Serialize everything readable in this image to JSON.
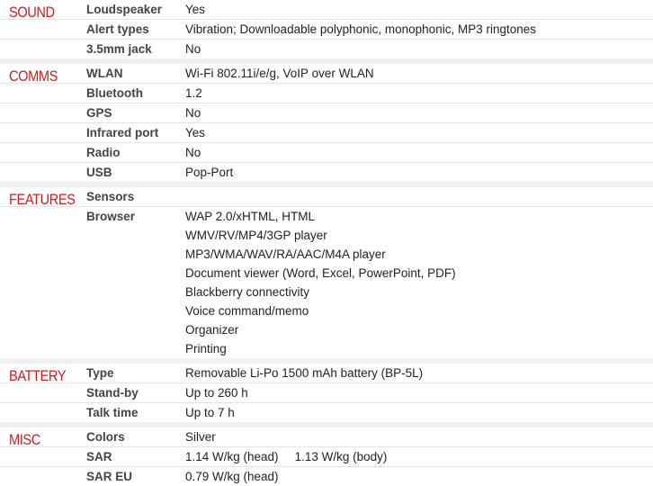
{
  "sections": [
    {
      "category": "SOUND",
      "rows": [
        {
          "label": "Loudspeaker",
          "value": "Yes"
        },
        {
          "label": "Alert types",
          "value": "Vibration; Downloadable polyphonic, monophonic, MP3 ringtones"
        },
        {
          "label": "3.5mm jack",
          "value": "No"
        }
      ]
    },
    {
      "category": "COMMS",
      "rows": [
        {
          "label": "WLAN",
          "value": "Wi-Fi 802.11i/e/g, VoIP over WLAN"
        },
        {
          "label": "Bluetooth",
          "value": "1.2"
        },
        {
          "label": "GPS",
          "value": "No"
        },
        {
          "label": "Infrared port",
          "value": "Yes"
        },
        {
          "label": "Radio",
          "value": "No"
        },
        {
          "label": "USB",
          "value": "Pop-Port"
        }
      ]
    },
    {
      "category": "FEATURES",
      "rows": [
        {
          "label": "Sensors",
          "value": ""
        },
        {
          "label": "Browser",
          "value": "WAP 2.0/xHTML, HTML"
        },
        {
          "label": "",
          "value": "WMV/RV/MP4/3GP player"
        },
        {
          "label": "",
          "value": "MP3/WMA/WAV/RA/AAC/M4A player"
        },
        {
          "label": "",
          "value": "Document viewer (Word, Excel, PowerPoint, PDF)"
        },
        {
          "label": "",
          "value": "Blackberry connectivity"
        },
        {
          "label": "",
          "value": "Voice command/memo"
        },
        {
          "label": "",
          "value": "Organizer"
        },
        {
          "label": "",
          "value": "Printing"
        }
      ]
    },
    {
      "category": "BATTERY",
      "rows": [
        {
          "label": "Type",
          "value": "Removable Li-Po 1500 mAh battery (BP-5L)"
        },
        {
          "label": "Stand-by",
          "value": "Up to 260 h"
        },
        {
          "label": "Talk time",
          "value": "Up to 7 h"
        }
      ]
    },
    {
      "category": "MISC",
      "rows": [
        {
          "label": "Colors",
          "value": "Silver"
        },
        {
          "label": "SAR",
          "value": "1.14 W/kg (head)",
          "value2": "1.13 W/kg (body)"
        },
        {
          "label": "SAR EU",
          "value": "0.79 W/kg (head)"
        }
      ]
    }
  ]
}
